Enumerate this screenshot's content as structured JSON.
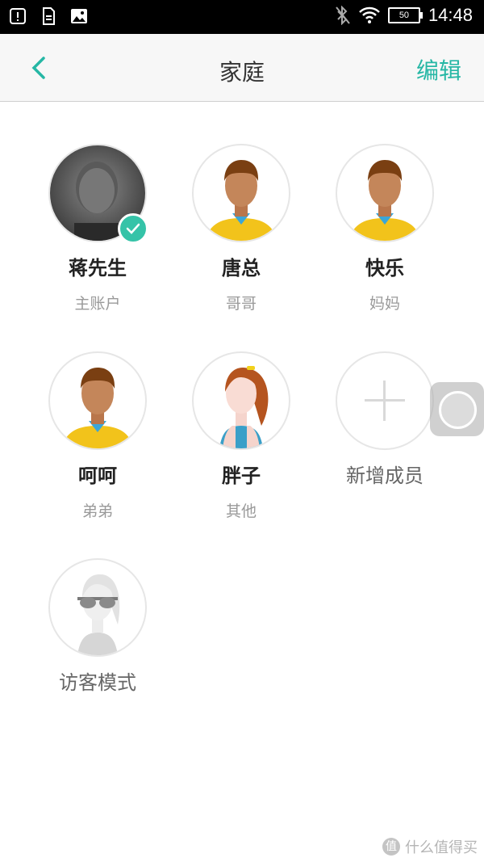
{
  "status_bar": {
    "battery": "50",
    "time": "14:48",
    "icons": [
      "alert-icon",
      "document-icon",
      "image-icon",
      "bluetooth-off-icon",
      "wifi-icon",
      "battery-icon"
    ]
  },
  "header": {
    "title": "家庭",
    "edit_label": "编辑",
    "back_icon": "chevron-left-icon"
  },
  "members": [
    {
      "name": "蒋先生",
      "role": "主账户",
      "avatar": "photo",
      "selected": true
    },
    {
      "name": "唐总",
      "role": "哥哥",
      "avatar": "male-cartoon"
    },
    {
      "name": "快乐",
      "role": "妈妈",
      "avatar": "male-cartoon"
    },
    {
      "name": "呵呵",
      "role": "弟弟",
      "avatar": "male-cartoon"
    },
    {
      "name": "胖子",
      "role": "其他",
      "avatar": "female-cartoon"
    }
  ],
  "add_member": {
    "label": "新增成员"
  },
  "guest_mode": {
    "label": "访客模式"
  },
  "watermark": {
    "text": "什么值得买",
    "icon_text": "值"
  },
  "colors": {
    "accent": "#26b7a5",
    "check": "#35c3a8"
  }
}
